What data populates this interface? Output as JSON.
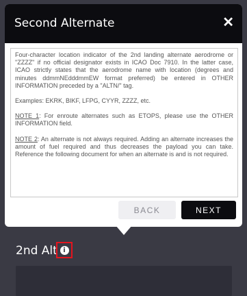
{
  "modal": {
    "title": "Second Alternate",
    "close_symbol": "✕",
    "paragraphs": [
      "Four-character location indicator of the 2nd landing alternate aerodrome or \"ZZZZ\" if no official designator exists in ICAO Doc 7910. In the latter case, ICAO strictly states that the aerodrome name with location (degrees and minutes ddmmNEdddmmEW format preferred) be entered in OTHER INFORMATION preceded by a \"ALTN/\" tag.",
      "Examples: EKRK, BIKF, LFPG, CYYR, ZZZZ, etc."
    ],
    "note1_label": "NOTE 1",
    "note1_text": ": For enroute alternates such as ETOPS, please use the OTHER INFORMATION field.",
    "note2_label": "NOTE 2",
    "note2_text": ": An alternate is not always required. Adding an alternate increases the amount of fuel required and thus decreases the payload you can take. Reference the following document for when an alternate is and is not required.",
    "back_label": "BACK",
    "next_label": "NEXT"
  },
  "field": {
    "label": "2nd Alt",
    "info_symbol": "i"
  },
  "icons": {
    "close": "close-icon",
    "info": "info-icon"
  },
  "colors": {
    "header_bg": "#0c0c10",
    "page_bg": "#3a3a44",
    "highlight": "#e4141e"
  }
}
